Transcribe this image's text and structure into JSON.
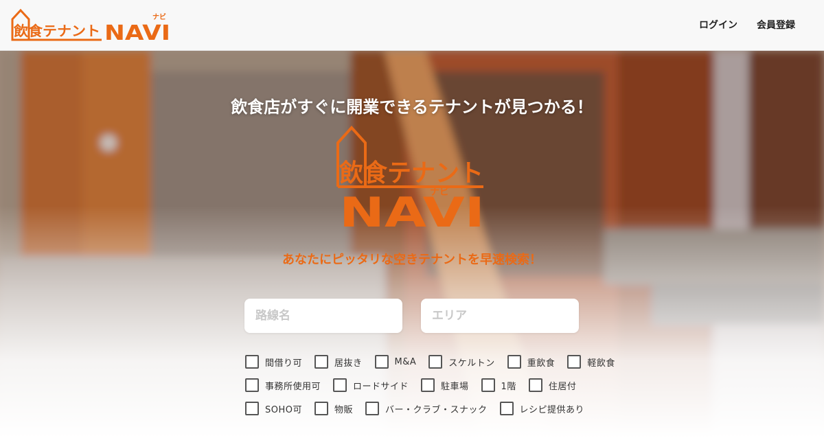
{
  "header": {
    "logo": {
      "text_main": "飲食テナント",
      "text_navi": "NAVI",
      "text_ruby": "ナビ"
    },
    "nav": [
      {
        "label": "ログイン"
      },
      {
        "label": "会員登録"
      }
    ]
  },
  "hero": {
    "tagline": "飲食店がすぐに開業できるテナントが見つかる！",
    "subtitle": "あなたにピッタリな空きテナントを早速検索！",
    "search": {
      "route_placeholder": "路線名",
      "area_placeholder": "エリア"
    },
    "checkboxes": {
      "row1": [
        {
          "label": "間借り可",
          "checked": false
        },
        {
          "label": "居抜き",
          "checked": false
        },
        {
          "label": "M&A",
          "checked": false
        },
        {
          "label": "スケルトン",
          "checked": false
        },
        {
          "label": "重飲食",
          "checked": false
        },
        {
          "label": "軽飲食",
          "checked": false
        }
      ],
      "row2": [
        {
          "label": "事務所使用可",
          "checked": false
        },
        {
          "label": "ロードサイド",
          "checked": false
        },
        {
          "label": "駐車場",
          "checked": false
        },
        {
          "label": "1階",
          "checked": false
        },
        {
          "label": "住居付",
          "checked": false
        }
      ],
      "row3": [
        {
          "label": "SOHO可",
          "checked": false
        },
        {
          "label": "物販",
          "checked": false
        },
        {
          "label": "バー・クラブ・スナック",
          "checked": false
        },
        {
          "label": "レシピ提供あり",
          "checked": false
        }
      ]
    }
  },
  "colors": {
    "brand_orange": "#ea6a16",
    "header_bg": "#f8f8f8"
  }
}
